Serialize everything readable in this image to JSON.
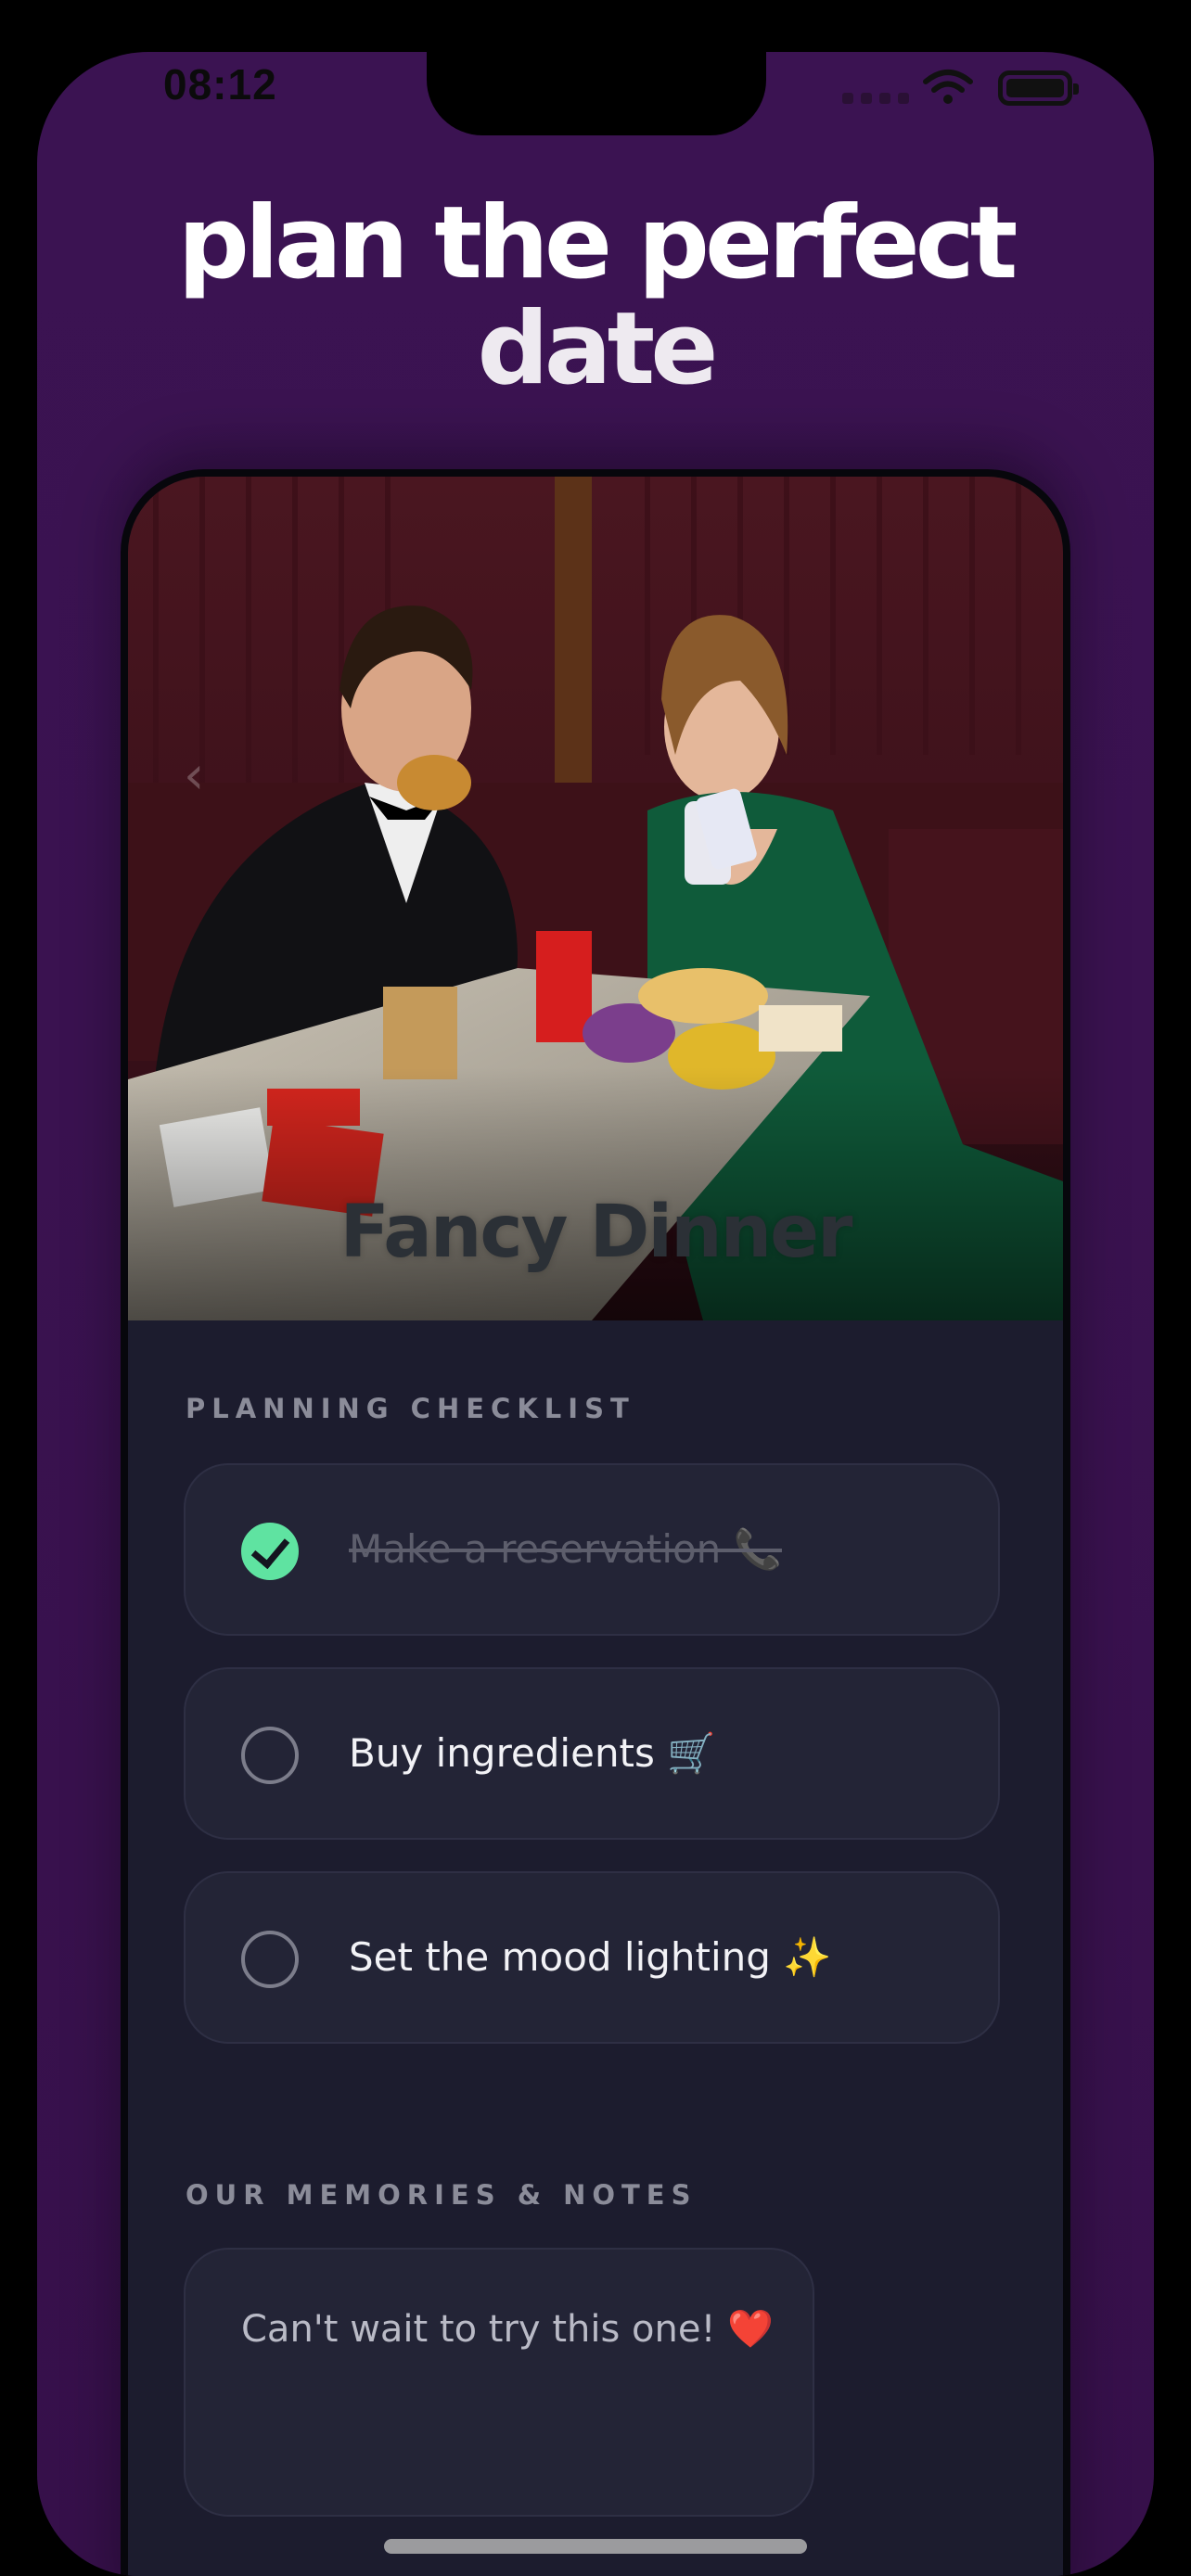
{
  "status_bar": {
    "time": "08:12"
  },
  "headline": {
    "line1": "plan the perfect",
    "line2": "date"
  },
  "hero": {
    "back_symbol": "‹",
    "title": "Fancy Dinner"
  },
  "checklist": {
    "label": "PLANNING CHECKLIST",
    "items": [
      {
        "text": "Make a reservation 📞",
        "done": true
      },
      {
        "text": "Buy ingredients 🛒",
        "done": false
      },
      {
        "text": "Set the mood lighting ✨",
        "done": false
      }
    ]
  },
  "memories": {
    "label": "OUR MEMORIES & NOTES",
    "note": "Can't wait to try this one! ❤️"
  },
  "colors": {
    "background": "#3a1250",
    "card": "#232436",
    "panel": "#1c1c2e",
    "check_done": "#5fe3a1"
  },
  "icons": [
    "wifi-icon",
    "battery-icon",
    "checkmark-icon",
    "back-arrow-icon"
  ]
}
